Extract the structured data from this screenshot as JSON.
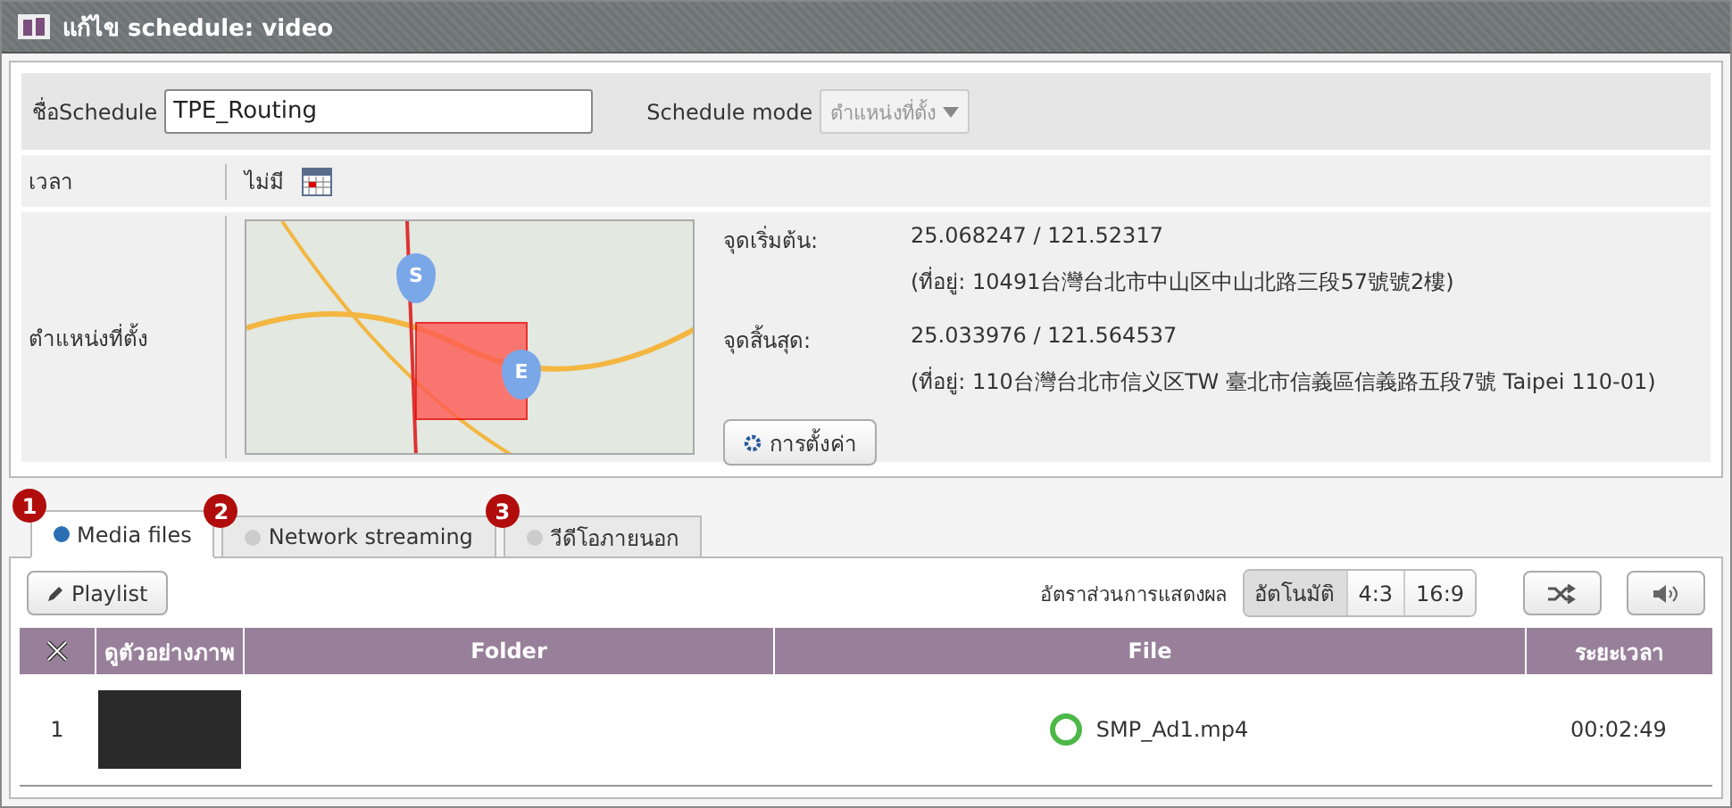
{
  "window": {
    "title": "แก้ไข schedule: video"
  },
  "form": {
    "name_label": "ชื่อSchedule",
    "name_value": "TPE_Routing",
    "mode_label": "Schedule mode",
    "mode_value": "ตำแหน่งที่ตั้ง",
    "mode_disabled": true,
    "time_label": "เวลา",
    "time_value": "ไม่มี",
    "location_label": "ตำแหน่งที่ตั้ง",
    "map_markers": [
      "S",
      "E"
    ],
    "start_label": "จุดเริ่มต้น:",
    "start_coords": "25.068247 / 121.52317",
    "start_address": "(ที่อยู่: 10491台灣台北市中山区中山北路三段57號號2樓)",
    "end_label": "จุดสิ้นสุด:",
    "end_coords": "25.033976 / 121.564537",
    "end_address": "(ที่อยู่: 110台灣台北市信义区TW 臺北市信義區信義路五段7號 Taipei 110-01)",
    "settings_button": "การตั้งค่า"
  },
  "tabs": [
    {
      "badge": "1",
      "label": "Media files",
      "selected": true
    },
    {
      "badge": "2",
      "label": "Network streaming",
      "selected": false
    },
    {
      "badge": "3",
      "label": "วีดีโอภายนอก",
      "selected": false
    }
  ],
  "toolbar": {
    "playlist_button": "Playlist",
    "ratio_label": "อัตราส่วนการแสดงผล",
    "ratios": [
      {
        "label": "อัตโนมัติ",
        "selected": true
      },
      {
        "label": "4:3",
        "selected": false
      },
      {
        "label": "16:9",
        "selected": false
      }
    ]
  },
  "table": {
    "columns": [
      "ดูตัวอย่างภาพ",
      "Folder",
      "File",
      "ระยะเวลา"
    ],
    "rows": [
      {
        "index": "1",
        "file": "SMP_Ad1.mp4",
        "duration": "00:02:49"
      }
    ]
  }
}
